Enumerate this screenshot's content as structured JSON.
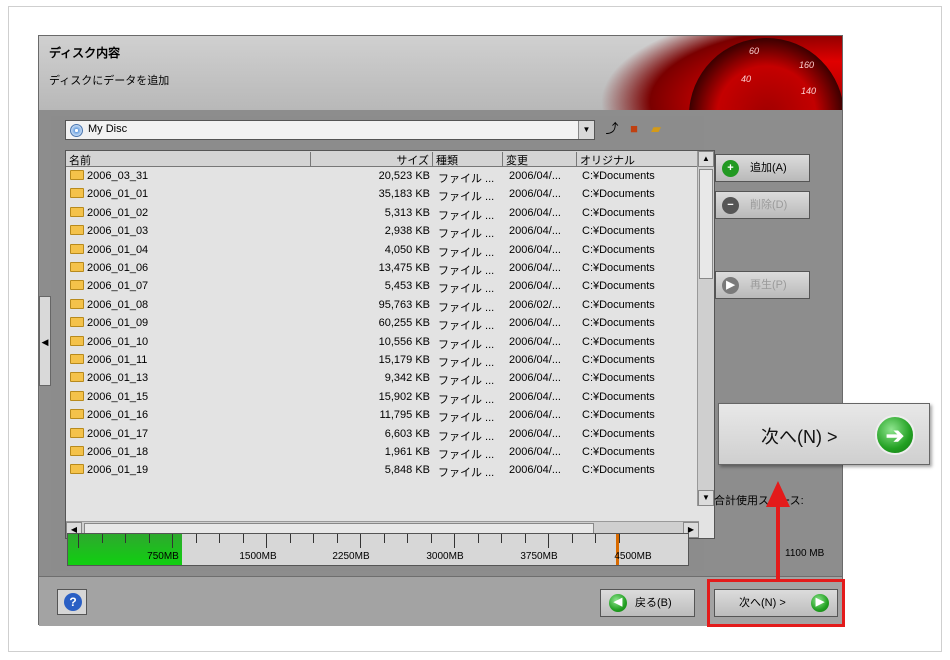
{
  "header": {
    "title": "ディスク内容",
    "subtitle": "ディスクにデータを追加",
    "dial_numbers": [
      "60",
      "160",
      "140",
      "40"
    ]
  },
  "disc_selector": {
    "value": "My Disc"
  },
  "file_list": {
    "columns": [
      "名前",
      "サイズ",
      "種類",
      "変更",
      "オリジナル"
    ],
    "rows": [
      {
        "name": "2006_03_31",
        "size": "20,523 KB",
        "type": "ファイル ...",
        "modified": "2006/04/...",
        "original": "C:¥Documents"
      },
      {
        "name": "2006_01_01",
        "size": "35,183 KB",
        "type": "ファイル ...",
        "modified": "2006/04/...",
        "original": "C:¥Documents"
      },
      {
        "name": "2006_01_02",
        "size": "5,313 KB",
        "type": "ファイル ...",
        "modified": "2006/04/...",
        "original": "C:¥Documents"
      },
      {
        "name": "2006_01_03",
        "size": "2,938 KB",
        "type": "ファイル ...",
        "modified": "2006/04/...",
        "original": "C:¥Documents"
      },
      {
        "name": "2006_01_04",
        "size": "4,050 KB",
        "type": "ファイル ...",
        "modified": "2006/04/...",
        "original": "C:¥Documents"
      },
      {
        "name": "2006_01_06",
        "size": "13,475 KB",
        "type": "ファイル ...",
        "modified": "2006/04/...",
        "original": "C:¥Documents"
      },
      {
        "name": "2006_01_07",
        "size": "5,453 KB",
        "type": "ファイル ...",
        "modified": "2006/04/...",
        "original": "C:¥Documents"
      },
      {
        "name": "2006_01_08",
        "size": "95,763 KB",
        "type": "ファイル ...",
        "modified": "2006/02/...",
        "original": "C:¥Documents"
      },
      {
        "name": "2006_01_09",
        "size": "60,255 KB",
        "type": "ファイル ...",
        "modified": "2006/04/...",
        "original": "C:¥Documents"
      },
      {
        "name": "2006_01_10",
        "size": "10,556 KB",
        "type": "ファイル ...",
        "modified": "2006/04/...",
        "original": "C:¥Documents"
      },
      {
        "name": "2006_01_11",
        "size": "15,179 KB",
        "type": "ファイル ...",
        "modified": "2006/04/...",
        "original": "C:¥Documents"
      },
      {
        "name": "2006_01_13",
        "size": "9,342 KB",
        "type": "ファイル ...",
        "modified": "2006/04/...",
        "original": "C:¥Documents"
      },
      {
        "name": "2006_01_15",
        "size": "15,902 KB",
        "type": "ファイル ...",
        "modified": "2006/04/...",
        "original": "C:¥Documents"
      },
      {
        "name": "2006_01_16",
        "size": "11,795 KB",
        "type": "ファイル ...",
        "modified": "2006/04/...",
        "original": "C:¥Documents"
      },
      {
        "name": "2006_01_17",
        "size": "6,603 KB",
        "type": "ファイル ...",
        "modified": "2006/04/...",
        "original": "C:¥Documents"
      },
      {
        "name": "2006_01_18",
        "size": "1,961 KB",
        "type": "ファイル ...",
        "modified": "2006/04/...",
        "original": "C:¥Documents"
      },
      {
        "name": "2006_01_19",
        "size": "5,848 KB",
        "type": "ファイル ...",
        "modified": "2006/04/...",
        "original": "C:¥Documents"
      }
    ]
  },
  "side_buttons": {
    "add": "追加(A)",
    "delete": "削除(D)",
    "play": "再生(P)"
  },
  "capacity": {
    "labels": [
      "750MB",
      "1500MB",
      "2250MB",
      "3000MB",
      "3750MB",
      "4500MB"
    ],
    "used_mb": 1100,
    "max_mb": 4700,
    "usage_label": "合計使用スペース:",
    "usage_value": "1100 MB"
  },
  "footer": {
    "back": "戻る(B)",
    "next": "次へ(N) >"
  },
  "callout": {
    "text": "次へ(N) >"
  },
  "colors": {
    "highlight": "#e31b1b",
    "accent_green": "#22a022"
  }
}
